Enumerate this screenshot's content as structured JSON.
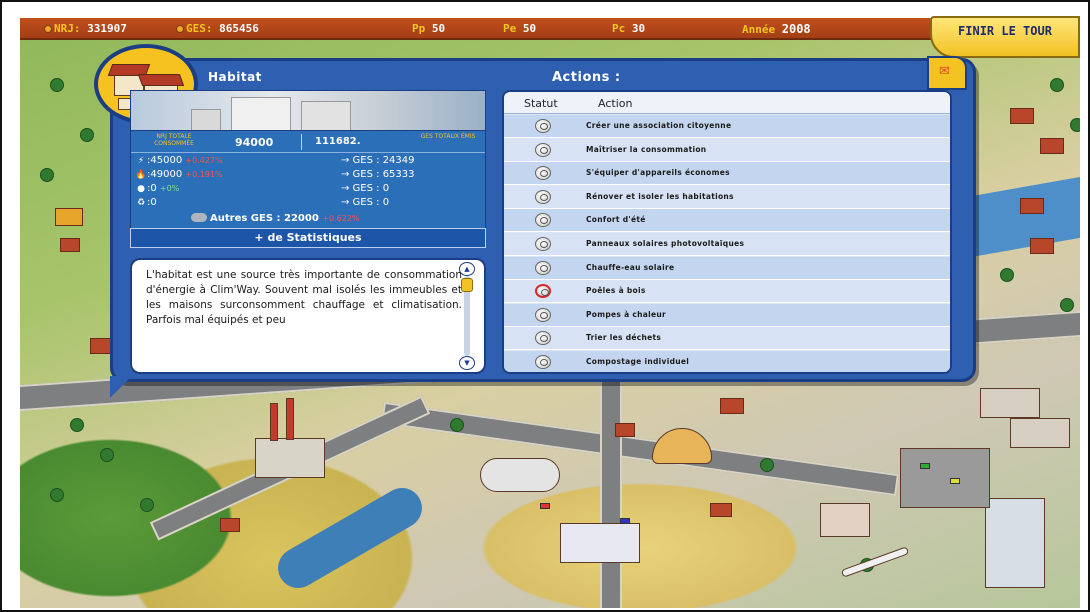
{
  "topbar": {
    "nrj_label": "NRJ:",
    "nrj_value": "331907",
    "ges_label": "GES:",
    "ges_value": "865456",
    "pp_label": "Pp",
    "pp_value": "50",
    "pe_label": "Pe",
    "pe_value": "50",
    "pc_label": "Pc",
    "pc_value": "30",
    "annee_label": "Année",
    "annee_value": "2008",
    "finish_label": "FINIR LE TOUR"
  },
  "panel": {
    "section_title": "Habitat",
    "actions_title": "Actions :"
  },
  "stats": {
    "nrj_total_label": "NRJ TOTALE CONSOMMÉE",
    "nrj_total_value": "94000",
    "ges_total_value": "111682.",
    "ges_total_label": "GES TOTAUX ÉMIS",
    "rows": [
      {
        "icon": "electricity-icon",
        "glyph": "⚡",
        "value": ":45000",
        "pct": "+0.427%",
        "pct_color": "red",
        "ges": "→ GES : 24349"
      },
      {
        "icon": "gas-flame-icon",
        "glyph": "🔥",
        "value": ":49000",
        "pct": "+0.191%",
        "pct_color": "red",
        "ges": "→ GES : 65333"
      },
      {
        "icon": "oil-drop-icon",
        "glyph": "●",
        "value": ":0",
        "pct": "+0%",
        "pct_color": "green",
        "ges": "→ GES : 0"
      },
      {
        "icon": "renewable-icon",
        "glyph": "♻",
        "value": ":0",
        "pct": "",
        "pct_color": "",
        "ges": "→ GES : 0"
      }
    ],
    "autres_label": "Autres GES : 22000",
    "autres_pct": "+0.622%",
    "more_stats_label": "+ de Statistiques"
  },
  "description": {
    "text": "L'habitat est une source très importante de consommation d'énergie à Clim'Way. Souvent mal isolés les immeubles et les maisons surconsomment chauffage et climatisation. Parfois mal équipés et peu"
  },
  "actions": {
    "col_status": "Statut",
    "col_action": "Action",
    "items": [
      {
        "label": "Créer une association citoyenne",
        "active": false
      },
      {
        "label": "Maîtriser la consommation",
        "active": false
      },
      {
        "label": "S'équiper d'appareils économes",
        "active": false
      },
      {
        "label": "Rénover et isoler les habitations",
        "active": false
      },
      {
        "label": "Confort d'été",
        "active": false
      },
      {
        "label": "Panneaux solaires photovoltaïques",
        "active": false
      },
      {
        "label": "Chauffe-eau solaire",
        "active": false
      },
      {
        "label": "Poêles à bois",
        "active": true
      },
      {
        "label": "Pompes à chaleur",
        "active": false
      },
      {
        "label": "Trier les déchets",
        "active": false
      },
      {
        "label": "Compostage individuel",
        "active": false
      }
    ]
  },
  "colors": {
    "panel_blue": "#2e5fb0",
    "accent_yellow": "#f6c21f",
    "topbar_orange": "#c24f1d",
    "active_status_red": "#d62b2b"
  }
}
